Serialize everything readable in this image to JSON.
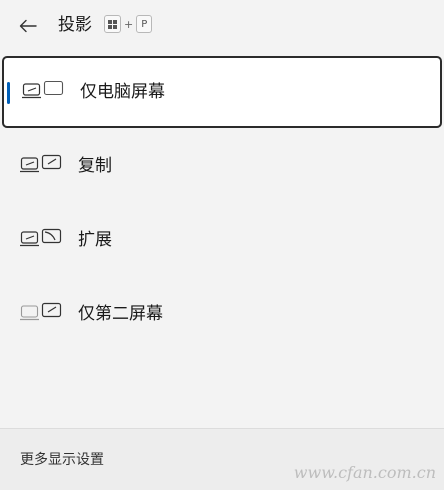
{
  "header": {
    "title": "投影",
    "shortcut": {
      "key1": "win-logo",
      "plus": "+",
      "key2": "P"
    }
  },
  "options": [
    {
      "label": "仅电脑屏幕",
      "icon": "pc-screen-only-icon",
      "selected": true
    },
    {
      "label": "复制",
      "icon": "duplicate-icon",
      "selected": false
    },
    {
      "label": "扩展",
      "icon": "extend-icon",
      "selected": false
    },
    {
      "label": "仅第二屏幕",
      "icon": "second-screen-only-icon",
      "selected": false
    }
  ],
  "footer": {
    "link": "更多显示设置"
  },
  "watermark": "www.cfan.com.cn",
  "colors": {
    "accent": "#005fb8",
    "panel": "#f3f3f3",
    "selected_bg": "#ffffff"
  }
}
